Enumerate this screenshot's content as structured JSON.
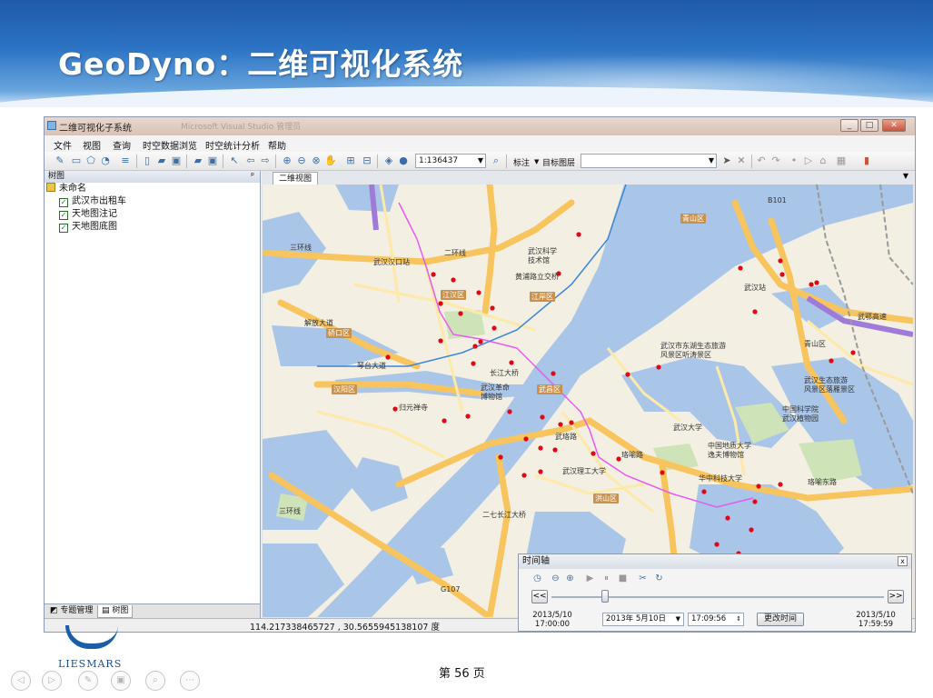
{
  "slide": {
    "title": "GeoDyno：二维可视化系统",
    "page_number": "第 56 页",
    "logo_text": "LIESMARS"
  },
  "window": {
    "title": "二维可视化子系统",
    "title_faded": "Microsoft Visual Studio 管理员",
    "controls": {
      "minimize": "_",
      "maximize": "□",
      "close": "✕"
    }
  },
  "menu": [
    "文件",
    "视图",
    "查询",
    "时空数据浏览",
    "时空统计分析",
    "帮助"
  ],
  "toolbar": {
    "scale_value": "1:136437",
    "annotation_label": "标注",
    "target_layer_label": "目标图层",
    "target_layer_value": ""
  },
  "left_panel": {
    "header": "树图",
    "pin": "ᵖ",
    "root": "未命名",
    "layers": [
      "武汉市出租车",
      "天地图注记",
      "天地图底图"
    ],
    "tabs": [
      "专题管理",
      "树图"
    ]
  },
  "map": {
    "tab": "二维视图",
    "labels": [
      "三环线",
      "二环线",
      "武汉汉口站",
      "武汉科学",
      "技术馆",
      "黄浦路立交桥",
      "江汉区",
      "江岸区",
      "解放大道",
      "硚口区",
      "琴台大道",
      "汉阳区",
      "武汉革命",
      "博物馆",
      "武昌区",
      "归元禅寺",
      "武珞路",
      "珞喻路",
      "武汉理工大学",
      "洪山区",
      "武汉大学",
      "中国地质大学",
      "逸夫博物馆",
      "华中科技大学",
      "珞喻东路",
      "青山区",
      "武汉站",
      "武鄂高速",
      "武汉市东湖生态旅游",
      "风景区听涛景区",
      "青山区",
      "武汉生态旅游",
      "风景区落雁景区",
      "中国科学院",
      "武汉植物园",
      "长江大桥",
      "B101",
      "G107",
      "二七长江大桥",
      "三环线"
    ],
    "point_color": "#e30613",
    "route_color": "#e65aee"
  },
  "status": {
    "coordinates": "114.217338465727 , 30.5655945138107 度"
  },
  "timeline": {
    "title": "时间轴",
    "close": "x",
    "prev": "<<",
    "next": ">>",
    "start_date": "2013/5/10",
    "start_time": "17:00:00",
    "end_date": "2013/5/10",
    "end_time": "17:59:59",
    "date_value": "2013年  5月10日",
    "time_value": "17:09:56",
    "change_button": "更改时间",
    "slider_fraction": 0.16
  },
  "nav_icons": [
    "prev-slide-icon",
    "next-slide-icon",
    "pen-icon",
    "slides-icon",
    "zoom-icon",
    "more-icon"
  ]
}
